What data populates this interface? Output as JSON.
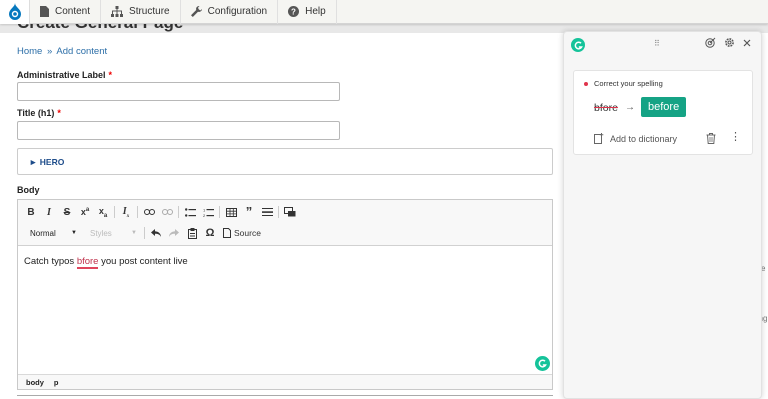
{
  "toolbar": {
    "logo_icon": "drupal-drop-icon",
    "items": [
      {
        "label": "Content",
        "icon": "file-icon"
      },
      {
        "label": "Structure",
        "icon": "sitemap-icon"
      },
      {
        "label": "Configuration",
        "icon": "wrench-icon"
      },
      {
        "label": "Help",
        "icon": "question-icon"
      }
    ]
  },
  "page": {
    "title": "Create General Page",
    "breadcrumb": {
      "home": "Home",
      "separator": "»",
      "current": "Add content"
    }
  },
  "form": {
    "admin_label": {
      "label": "Administrative Label",
      "required": "*",
      "value": ""
    },
    "title": {
      "label": "Title (h1)",
      "required": "*",
      "value": ""
    },
    "hero": {
      "label": "► HERO"
    },
    "body": {
      "label": "Body",
      "toolbar": {
        "format_select": "Normal",
        "styles_select": "Styles",
        "source_label": "Source"
      },
      "content": {
        "before": "Catch typos ",
        "misspelled": "bfore",
        "after": " you post content live"
      },
      "status_path": [
        "body",
        "p"
      ]
    }
  },
  "right_snips": [
    "e",
    "ling",
    "",
    ""
  ],
  "grammarly": {
    "accent": "#15c39a",
    "suggestion": {
      "category": "Correct your spelling",
      "original": "bfore",
      "arrow": "→",
      "replacement": "before"
    },
    "add_to_dictionary": "Add to dictionary",
    "drag_handle": "⠿"
  }
}
